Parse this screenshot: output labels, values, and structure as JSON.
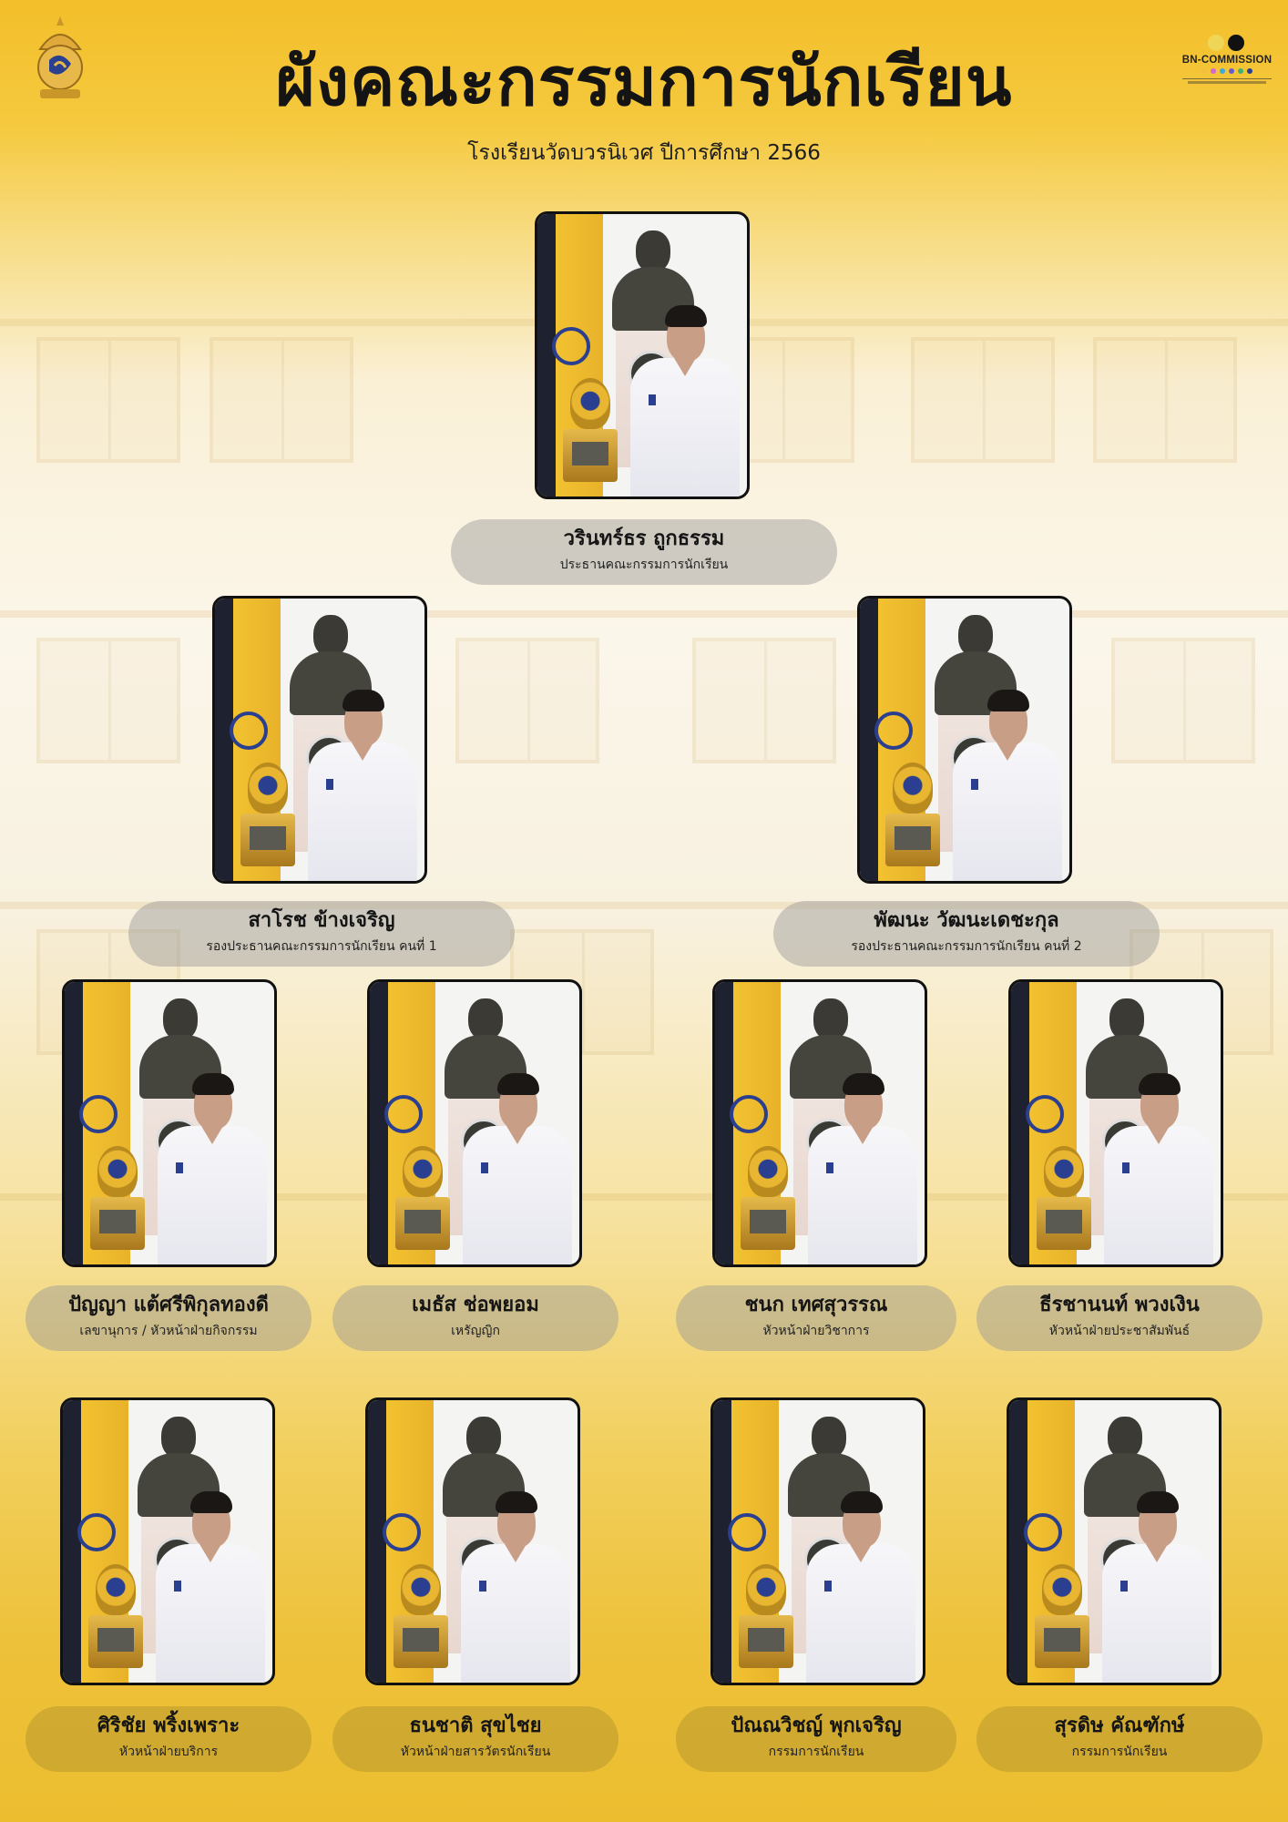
{
  "header": {
    "title": "ผังคณะกรรมการนักเรียน",
    "subtitle": "โรงเรียนวัดบวรนิเวศ ปีการศึกษา 2566",
    "brand": "BN-COMMISSION"
  },
  "colors": {
    "accent": "#f3bf2a",
    "label_gray": "#969696",
    "label_gold": "#af912d"
  },
  "members": [
    {
      "name": "วรินทร์ธร ถูกธรรม",
      "role": "ประธานคณะกรรมการนักเรียน"
    },
    {
      "name": "สาโรช ข้างเจริญ",
      "role": "รองประธานคณะกรรมการนักเรียน คนที่ 1"
    },
    {
      "name": "พัฒนะ วัฒนะเดชะกุล",
      "role": "รองประธานคณะกรรมการนักเรียน คนที่ 2"
    },
    {
      "name": "ปัญญา แต้ศรีพิกุลทองดี",
      "role": "เลขานุการ / หัวหน้าฝ่ายกิจกรรม"
    },
    {
      "name": "เมธัส ช่อพยอม",
      "role": "เหรัญญิก"
    },
    {
      "name": "ชนก เทศสุวรรณ",
      "role": "หัวหน้าฝ่ายวิชาการ"
    },
    {
      "name": "ธีรชานนท์ พวงเงิน",
      "role": "หัวหน้าฝ่ายประชาสัมพันธ์"
    },
    {
      "name": "ศิริชัย พริ้งเพราะ",
      "role": "หัวหน้าฝ่ายบริการ"
    },
    {
      "name": "ธนชาติ สุขไชย",
      "role": "หัวหน้าฝ่ายสารวัตรนักเรียน"
    },
    {
      "name": "ปัณณวิชญ์ พุกเจริญ",
      "role": "กรรมการนักเรียน"
    },
    {
      "name": "สุรดิษ คัณฑักษ์",
      "role": "กรรมการนักเรียน"
    }
  ]
}
